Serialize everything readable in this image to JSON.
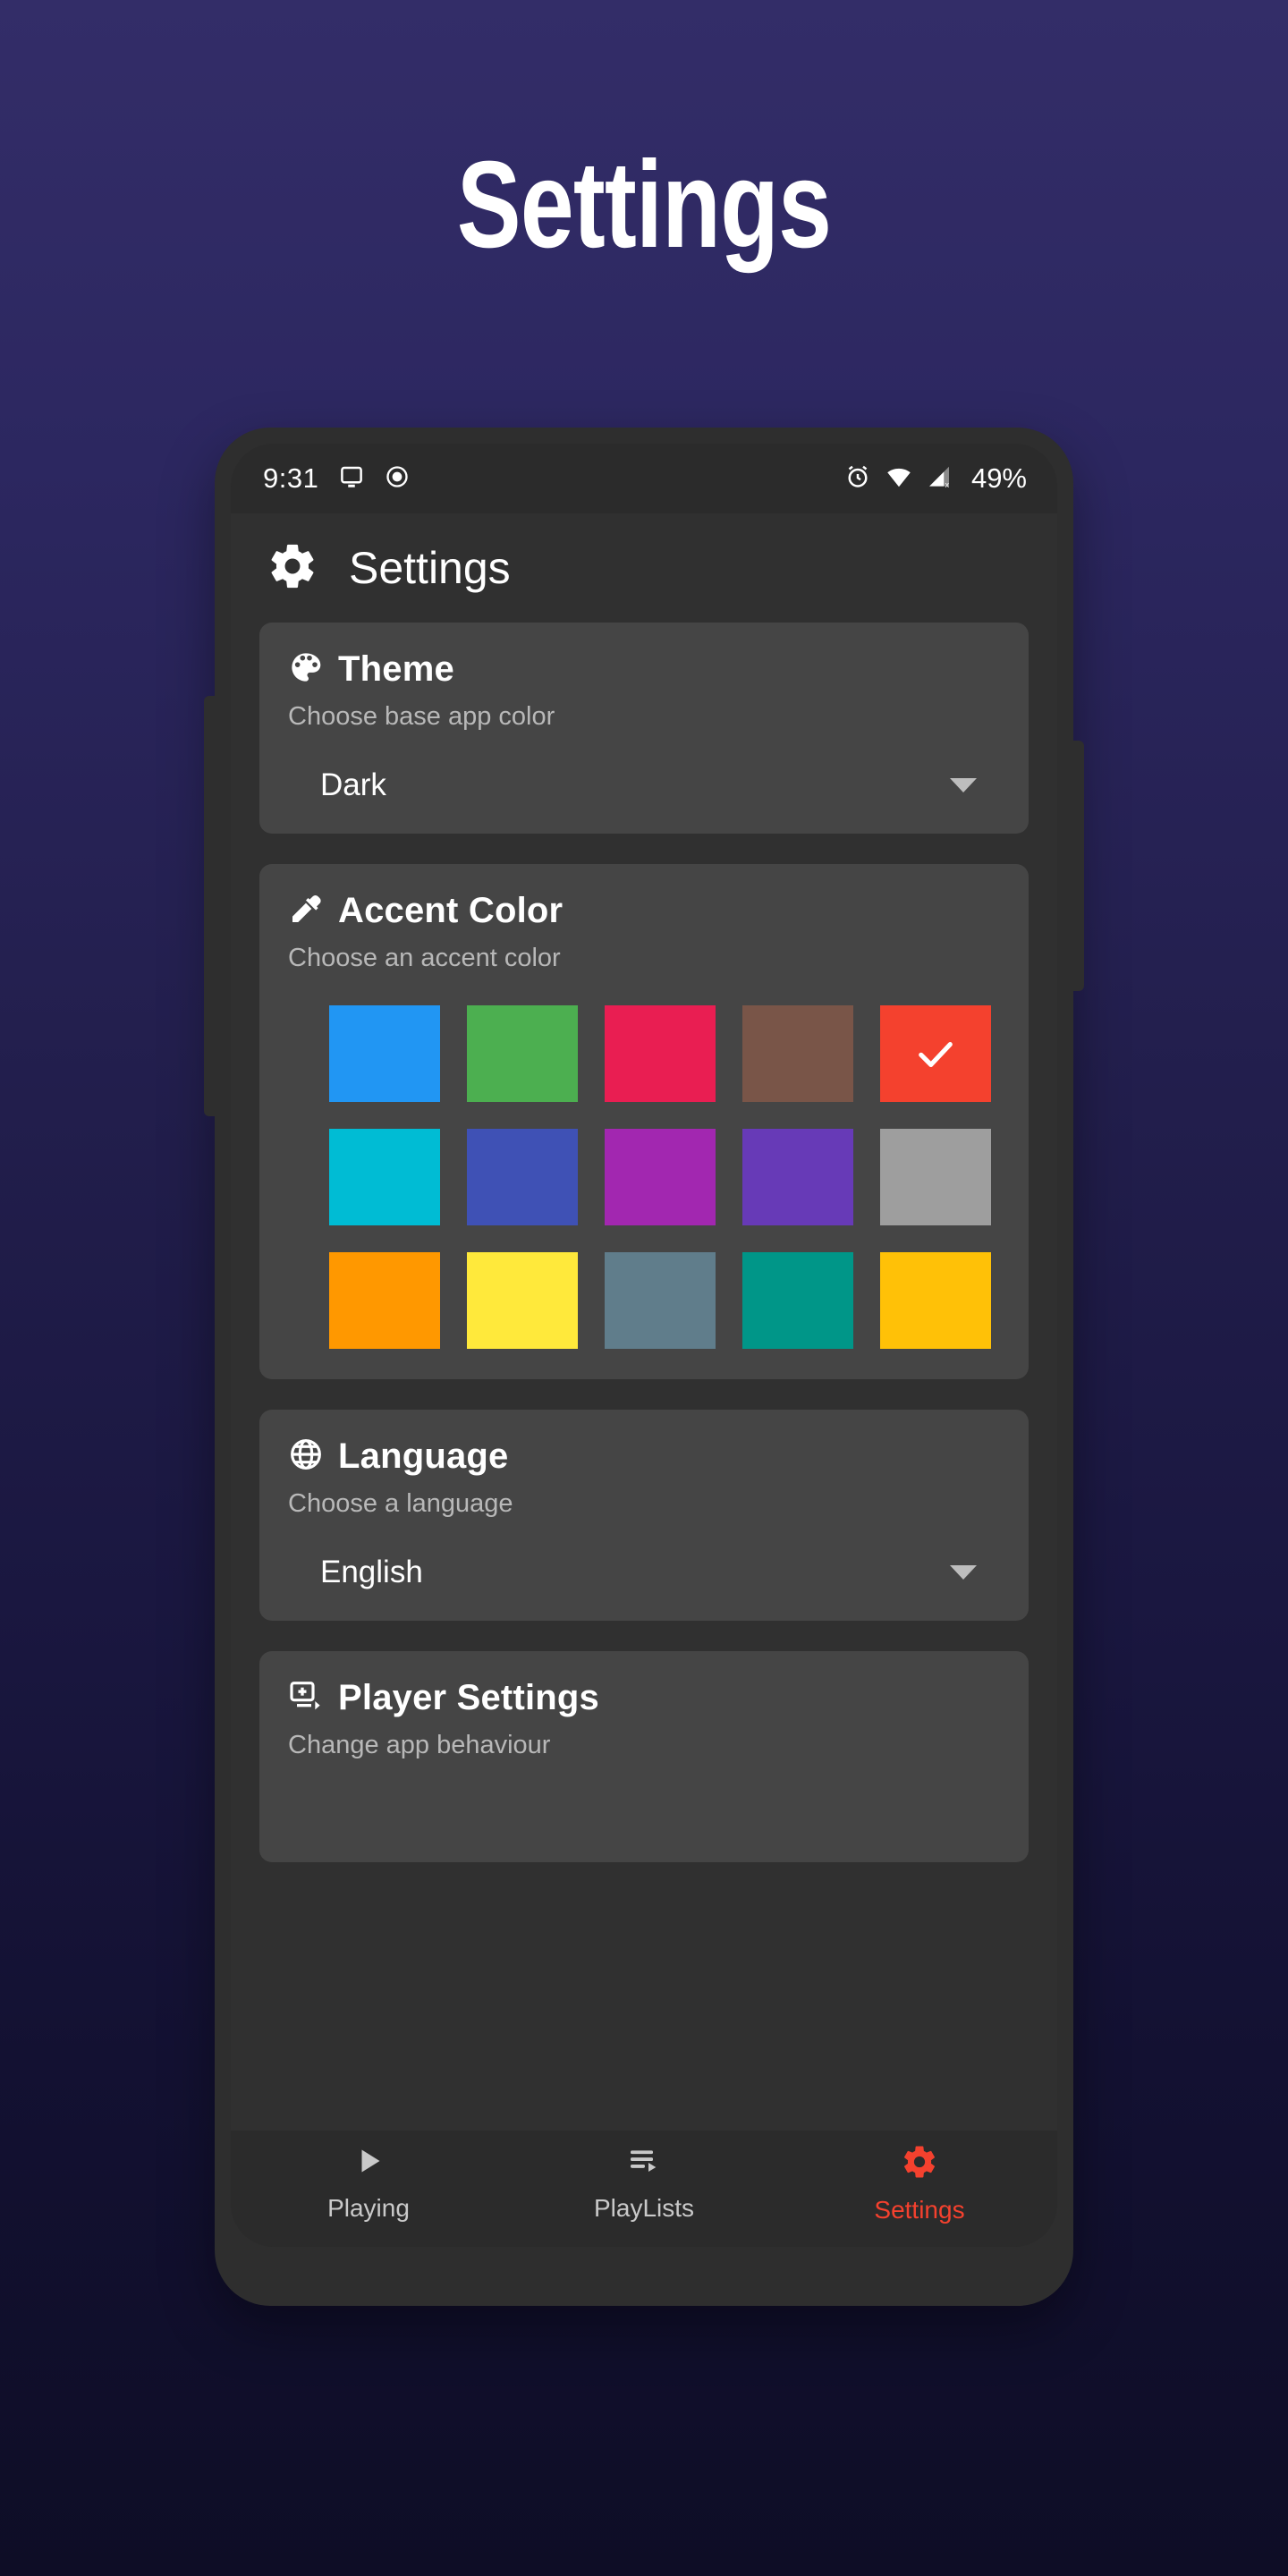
{
  "page": {
    "title": "Settings",
    "background_top": "#332d68",
    "background_bottom": "#0e0d26"
  },
  "status_bar": {
    "clock": "9:31",
    "battery": "49%",
    "left_icons": [
      "cast-icon",
      "record-dot-icon"
    ],
    "right_icons": [
      "alarm-icon",
      "wifi-icon",
      "cellular-signal-off-icon"
    ]
  },
  "app_bar": {
    "icon": "gear-icon",
    "title": "Settings"
  },
  "cards": {
    "theme": {
      "icon": "palette-icon",
      "title": "Theme",
      "subtitle": "Choose base app color",
      "selected": "Dark"
    },
    "accent": {
      "icon": "eyedropper-icon",
      "title": "Accent Color",
      "subtitle": "Choose an accent color",
      "selected_index": 4,
      "swatches": [
        {
          "name": "blue",
          "hex": "#2196f3"
        },
        {
          "name": "green",
          "hex": "#4caf50"
        },
        {
          "name": "pink",
          "hex": "#e91e52"
        },
        {
          "name": "brown",
          "hex": "#795548"
        },
        {
          "name": "red",
          "hex": "#f4412e"
        },
        {
          "name": "cyan",
          "hex": "#00bcd4"
        },
        {
          "name": "indigo",
          "hex": "#3f51b5"
        },
        {
          "name": "purple",
          "hex": "#a227b0"
        },
        {
          "name": "deep-purple",
          "hex": "#673ab7"
        },
        {
          "name": "grey",
          "hex": "#9e9e9e"
        },
        {
          "name": "orange",
          "hex": "#ff9800"
        },
        {
          "name": "yellow",
          "hex": "#ffe93b"
        },
        {
          "name": "blue-grey",
          "hex": "#607d8b"
        },
        {
          "name": "teal",
          "hex": "#009688"
        },
        {
          "name": "amber",
          "hex": "#ffc107"
        }
      ]
    },
    "language": {
      "icon": "globe-icon",
      "title": "Language",
      "subtitle": "Choose a language",
      "selected": "English"
    },
    "player": {
      "icon": "add-to-queue-icon",
      "title": "Player Settings",
      "subtitle": "Change app behaviour"
    }
  },
  "bottom_nav": {
    "items": [
      {
        "label": "Playing",
        "icon": "play-icon",
        "active": false
      },
      {
        "label": "PlayLists",
        "icon": "playlist-icon",
        "active": false
      },
      {
        "label": "Settings",
        "icon": "gear-icon",
        "active": true
      }
    ],
    "active_color": "#f4412e"
  }
}
